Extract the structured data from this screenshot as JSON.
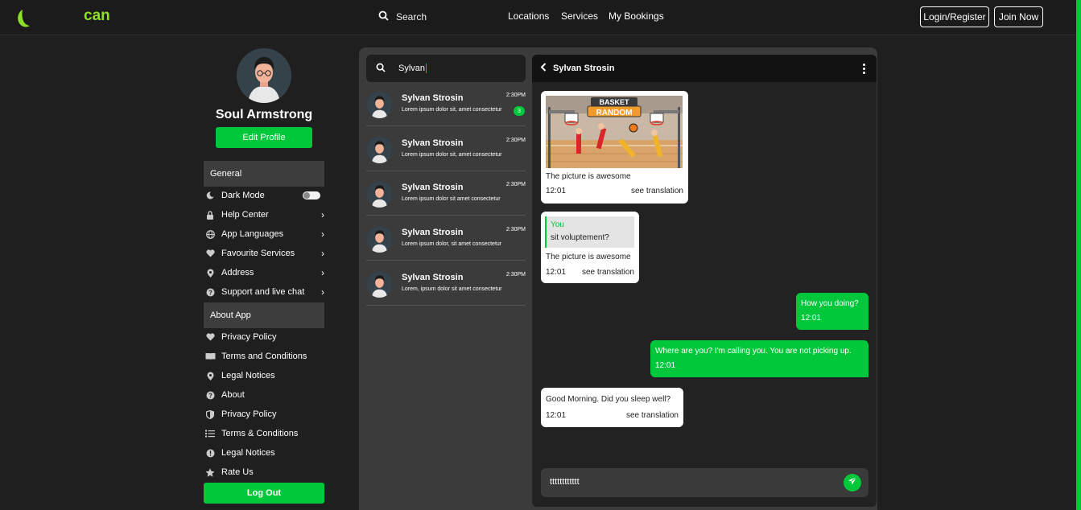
{
  "header": {
    "logo_text": "can",
    "search_label": "Search",
    "nav": [
      "Locations",
      "Services",
      "My Bookings"
    ],
    "login_label": "Login/Register",
    "join_label": "Join Now"
  },
  "profile": {
    "name": "Soul Armstrong",
    "edit_label": "Edit Profile"
  },
  "sidebar": {
    "general_title": "General",
    "general_items": [
      {
        "label": "Dark Mode",
        "icon": "moon-icon",
        "toggle": true
      },
      {
        "label": "Help Center",
        "icon": "lock-icon"
      },
      {
        "label": "App Languages",
        "icon": "globe-icon"
      },
      {
        "label": "Favourite Services",
        "icon": "heart-icon"
      },
      {
        "label": "Address",
        "icon": "location-pin-icon"
      },
      {
        "label": "Support and live chat",
        "icon": "help-circle-icon"
      }
    ],
    "about_title": "About App",
    "about_items": [
      {
        "label": "Privacy Policy",
        "icon": "heart-icon"
      },
      {
        "label": "Terms and Conditions",
        "icon": "book-icon"
      },
      {
        "label": "Legal Notices",
        "icon": "location-pin-icon"
      },
      {
        "label": "About",
        "icon": "help-circle-icon"
      },
      {
        "label": "Privacy Policy",
        "icon": "shield-icon"
      },
      {
        "label": "Terms & Conditions",
        "icon": "list-icon"
      },
      {
        "label": "Legal Notices",
        "icon": "info-icon"
      },
      {
        "label": "Rate Us",
        "icon": "star-icon"
      }
    ],
    "logout_label": "Log Out"
  },
  "chat_list": {
    "search_value": "Sylvan",
    "conversations": [
      {
        "name": "Sylvan Strosin",
        "time": "2:30PM",
        "preview": "Lorem ipsum dolor sit, amet consectetur",
        "unread": "3"
      },
      {
        "name": "Sylvan Strosin",
        "time": "2:30PM",
        "preview": "Lorem ipsum dolor sit, amet consectetur"
      },
      {
        "name": "Sylvan Strosin",
        "time": "2:30PM",
        "preview": "Lorem ipsum dolor sit amet consectetur"
      },
      {
        "name": "Sylvan Strosin",
        "time": "2:30PM",
        "preview": "Lorem ipsum dolor, sit amet consectetur"
      },
      {
        "name": "Sylvan Strosin",
        "time": "2:30PM",
        "preview": "Lorem, ipsum dolor sit amet consectetur"
      }
    ]
  },
  "chat": {
    "contact_name": "Sylvan Strosin",
    "messages": [
      {
        "direction": "in",
        "image_title": "BASKET RANDOM",
        "text": "The picture is awesome",
        "time": "12:01",
        "translate": "see translation"
      },
      {
        "direction": "in",
        "reply_name": "You",
        "reply_text": "sit voluptement?",
        "text": "The picture is awesome",
        "time": "12:01",
        "translate": "see translation"
      },
      {
        "direction": "out",
        "text": "How you doing?",
        "time": "12:01"
      },
      {
        "direction": "out",
        "text": "Where are you? I'm calling you. You are not picking up.",
        "time": "12:01"
      },
      {
        "direction": "in",
        "text": "Good Morning. Did you sleep well?",
        "time": "12:01",
        "translate": "see translation"
      }
    ],
    "composer_value": "tttttttttttt"
  },
  "colors": {
    "accent": "#00c83a",
    "logo": "#8ddf2a",
    "background": "#1f1f1f"
  }
}
